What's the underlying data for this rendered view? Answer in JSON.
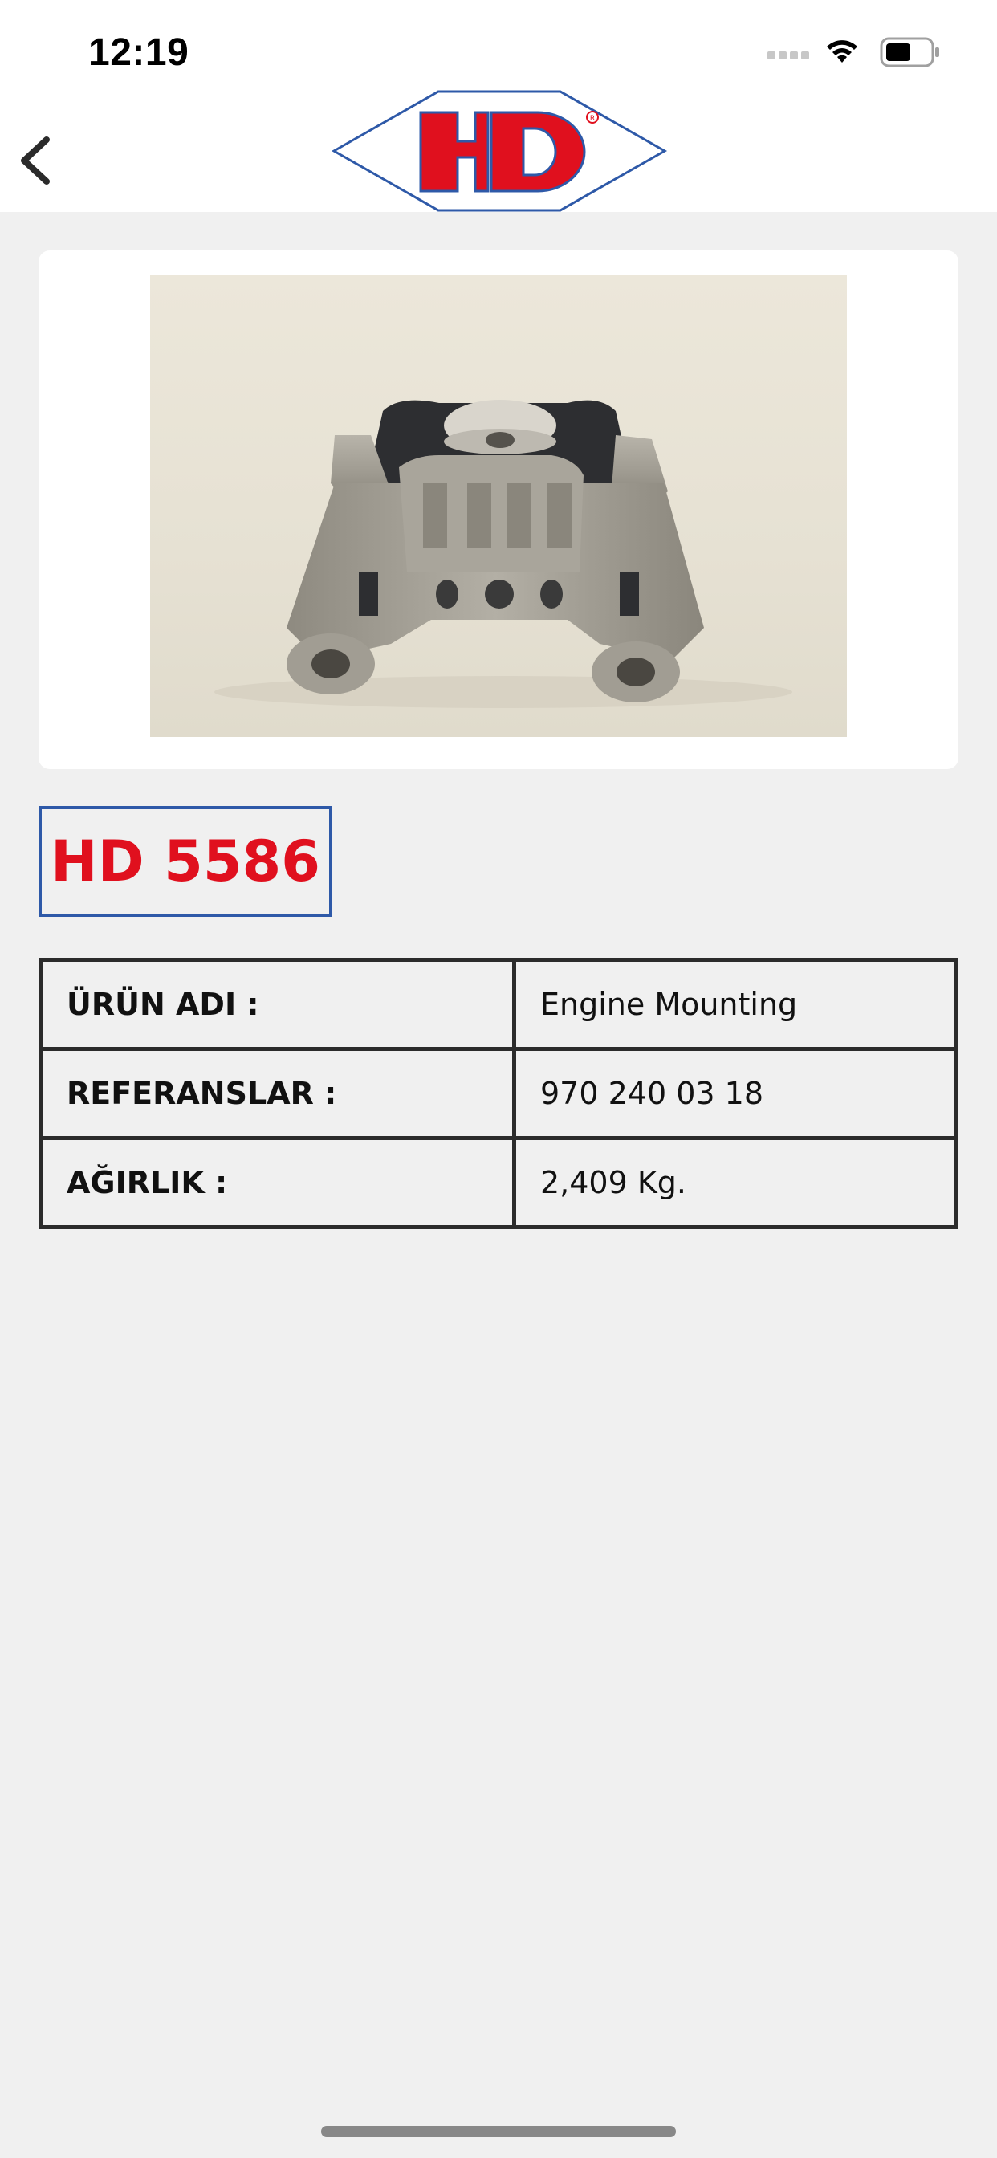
{
  "status_bar": {
    "time": "12:19",
    "icons": [
      "signal-icon",
      "wifi-icon",
      "battery-icon"
    ]
  },
  "nav": {
    "back_icon": "chevron-left-icon",
    "logo_text": "HD",
    "logo_mark": "®"
  },
  "product": {
    "image_alt": "engine mounting photo",
    "code": "HD 5586",
    "specs": [
      {
        "label": "ÜRÜN ADI :",
        "value": "Engine Mounting"
      },
      {
        "label": "REFERANSLAR :",
        "value": "970 240 03 18"
      },
      {
        "label": "AĞIRLIK :",
        "value": "2,409 Kg."
      }
    ]
  },
  "colors": {
    "brand_red": "#e0101e",
    "brand_blue": "#2e59a8",
    "background": "#f0f0f0"
  }
}
